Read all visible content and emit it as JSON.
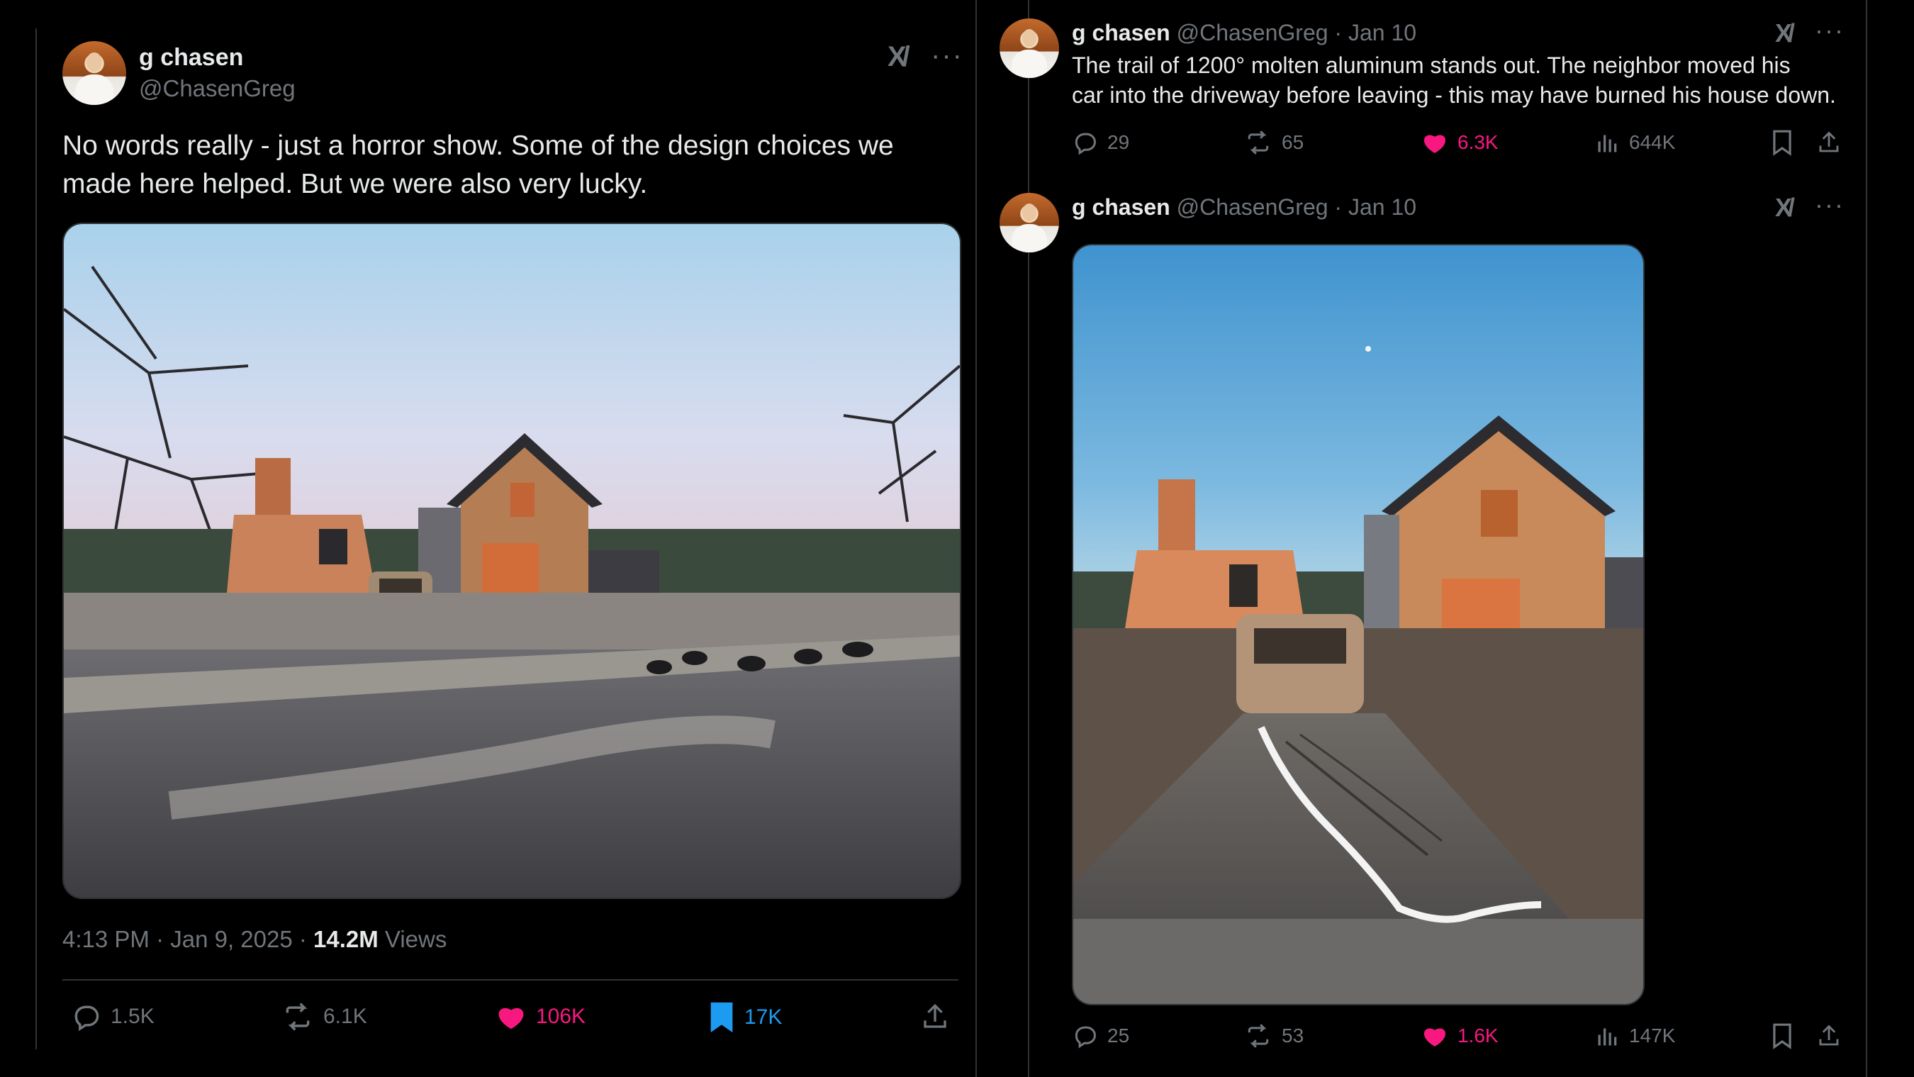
{
  "main_tweet": {
    "author_name": "g chasen",
    "handle": "@ChasenGreg",
    "text_line1": "No words really - just a horror show. Some of the design choices we",
    "text_line2": "made here helped. But we were also very lucky.",
    "timestamp": "4:13 PM · Jan 9, 2025 · ",
    "views_count": "14.2M",
    "views_label": " Views",
    "replies": "1.5K",
    "reposts": "6.1K",
    "likes": "106K",
    "bookmarks": "17K"
  },
  "reply1": {
    "author_name": "g chasen",
    "handle_date": "@ChasenGreg · Jan 10",
    "text_line1": "The trail of 1200° molten aluminum stands out.  The neighbor moved his",
    "text_line2": "car into the driveway before leaving - this may have burned his house down.",
    "replies": "29",
    "reposts": "65",
    "likes": "6.3K",
    "views": "644K"
  },
  "reply2": {
    "author_name": "g chasen",
    "handle_date": "@ChasenGreg · Jan 10",
    "replies": "25",
    "reposts": "53",
    "likes": "1.6K",
    "views": "147K"
  },
  "colors": {
    "background": "#000000",
    "text": "#e7e9ea",
    "muted": "#71767b",
    "like_pink": "#f91880",
    "bookmark_blue": "#1d9bf0",
    "divider": "#2f3336"
  },
  "icons": [
    "grok-icon",
    "more-icon",
    "reply-icon",
    "repost-icon",
    "heart-icon",
    "bookmark-icon",
    "share-icon",
    "views-icon"
  ]
}
